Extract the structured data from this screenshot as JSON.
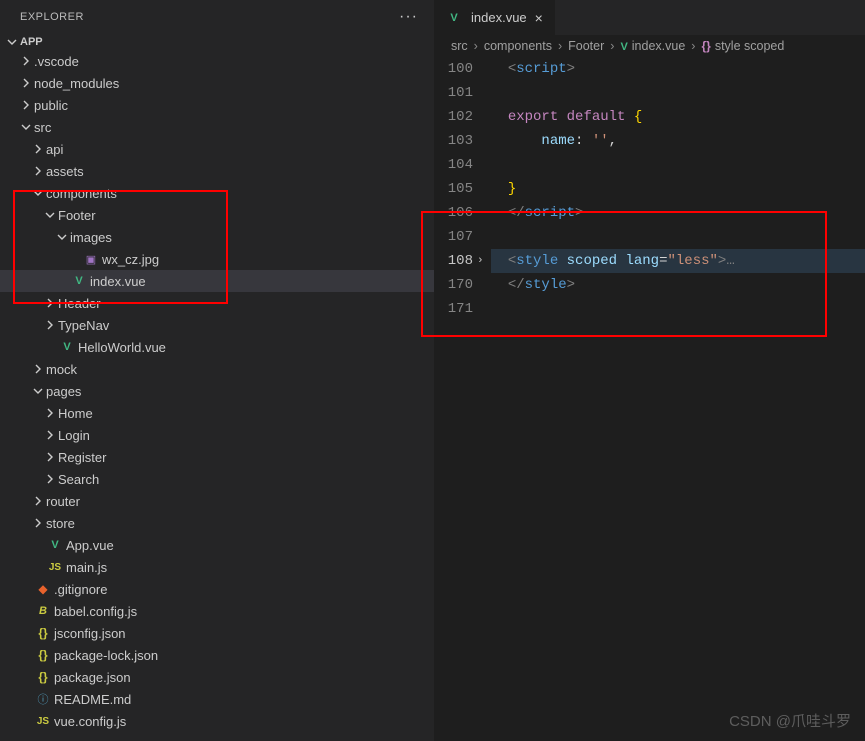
{
  "explorer": {
    "title": "EXPLORER",
    "section": "APP",
    "tree": [
      {
        "label": ".vscode",
        "icon": "chev-right",
        "indent": 1,
        "type": "folder-closed"
      },
      {
        "label": "node_modules",
        "icon": "chev-right",
        "indent": 1,
        "type": "folder-closed"
      },
      {
        "label": "public",
        "icon": "chev-right",
        "indent": 1,
        "type": "folder-closed"
      },
      {
        "label": "src",
        "icon": "chev-down",
        "indent": 1,
        "type": "folder-open"
      },
      {
        "label": "api",
        "icon": "chev-right",
        "indent": 2,
        "type": "folder-closed"
      },
      {
        "label": "assets",
        "icon": "chev-right",
        "indent": 2,
        "type": "folder-closed"
      },
      {
        "label": "components",
        "icon": "chev-down",
        "indent": 2,
        "type": "folder-open",
        "hl": true
      },
      {
        "label": "Footer",
        "icon": "chev-down",
        "indent": 3,
        "type": "folder-open",
        "hl": true
      },
      {
        "label": "images",
        "icon": "chev-down",
        "indent": 4,
        "type": "folder-open",
        "hl": true
      },
      {
        "label": "wx_cz.jpg",
        "icon": "image",
        "indent": 5,
        "type": "file",
        "hl": true
      },
      {
        "label": "index.vue",
        "icon": "vue",
        "indent": 4,
        "type": "file",
        "hl": true,
        "active": true
      },
      {
        "label": "Header",
        "icon": "chev-right",
        "indent": 3,
        "type": "folder-closed"
      },
      {
        "label": "TypeNav",
        "icon": "chev-right",
        "indent": 3,
        "type": "folder-closed"
      },
      {
        "label": "HelloWorld.vue",
        "icon": "vue",
        "indent": 3,
        "type": "file"
      },
      {
        "label": "mock",
        "icon": "chev-right",
        "indent": 2,
        "type": "folder-closed"
      },
      {
        "label": "pages",
        "icon": "chev-down",
        "indent": 2,
        "type": "folder-open"
      },
      {
        "label": "Home",
        "icon": "chev-right",
        "indent": 3,
        "type": "folder-closed"
      },
      {
        "label": "Login",
        "icon": "chev-right",
        "indent": 3,
        "type": "folder-closed"
      },
      {
        "label": "Register",
        "icon": "chev-right",
        "indent": 3,
        "type": "folder-closed"
      },
      {
        "label": "Search",
        "icon": "chev-right",
        "indent": 3,
        "type": "folder-closed"
      },
      {
        "label": "router",
        "icon": "chev-right",
        "indent": 2,
        "type": "folder-closed"
      },
      {
        "label": "store",
        "icon": "chev-right",
        "indent": 2,
        "type": "folder-closed"
      },
      {
        "label": "App.vue",
        "icon": "vue",
        "indent": 2,
        "type": "file"
      },
      {
        "label": "main.js",
        "icon": "js",
        "indent": 2,
        "type": "file"
      },
      {
        "label": ".gitignore",
        "icon": "git",
        "indent": 1,
        "type": "file"
      },
      {
        "label": "babel.config.js",
        "icon": "babel",
        "indent": 1,
        "type": "file"
      },
      {
        "label": "jsconfig.json",
        "icon": "braces",
        "indent": 1,
        "type": "file"
      },
      {
        "label": "package-lock.json",
        "icon": "braces",
        "indent": 1,
        "type": "file"
      },
      {
        "label": "package.json",
        "icon": "braces",
        "indent": 1,
        "type": "file"
      },
      {
        "label": "README.md",
        "icon": "info",
        "indent": 1,
        "type": "file"
      },
      {
        "label": "vue.config.js",
        "icon": "js",
        "indent": 1,
        "type": "file"
      }
    ]
  },
  "tab": {
    "label": "index.vue",
    "close": "×"
  },
  "breadcrumb": [
    "src",
    "components",
    "Footer",
    "index.vue",
    "style scoped"
  ],
  "code": {
    "lines": [
      {
        "n": "100",
        "tokens": [
          {
            "t": "  ",
            "c": "punc"
          },
          {
            "t": "<",
            "c": "tag"
          },
          {
            "t": "script",
            "c": "name"
          },
          {
            "t": ">",
            "c": "tag"
          }
        ]
      },
      {
        "n": "101",
        "tokens": []
      },
      {
        "n": "102",
        "tokens": [
          {
            "t": "  ",
            "c": "punc"
          },
          {
            "t": "export",
            "c": "kw"
          },
          {
            "t": " ",
            "c": "punc"
          },
          {
            "t": "default",
            "c": "kw"
          },
          {
            "t": " ",
            "c": "punc"
          },
          {
            "t": "{",
            "c": "brace"
          }
        ]
      },
      {
        "n": "103",
        "tokens": [
          {
            "t": "      ",
            "c": "punc"
          },
          {
            "t": "name",
            "c": "attr"
          },
          {
            "t": ":",
            "c": "punc"
          },
          {
            "t": " ",
            "c": "punc"
          },
          {
            "t": "''",
            "c": "str"
          },
          {
            "t": ",",
            "c": "punc"
          }
        ]
      },
      {
        "n": "104",
        "tokens": []
      },
      {
        "n": "105",
        "tokens": [
          {
            "t": "  ",
            "c": "punc"
          },
          {
            "t": "}",
            "c": "brace"
          }
        ]
      },
      {
        "n": "106",
        "tokens": [
          {
            "t": "  ",
            "c": "punc"
          },
          {
            "t": "</",
            "c": "tag"
          },
          {
            "t": "script",
            "c": "name"
          },
          {
            "t": ">",
            "c": "tag"
          }
        ]
      },
      {
        "n": "107",
        "tokens": []
      },
      {
        "n": "108",
        "current": true,
        "fold": true,
        "tokens": [
          {
            "t": "  ",
            "c": "punc"
          },
          {
            "t": "<",
            "c": "tag"
          },
          {
            "t": "style",
            "c": "name"
          },
          {
            "t": " ",
            "c": "punc"
          },
          {
            "t": "scoped",
            "c": "attr"
          },
          {
            "t": " ",
            "c": "punc"
          },
          {
            "t": "lang",
            "c": "attr"
          },
          {
            "t": "=",
            "c": "punc"
          },
          {
            "t": "\"less\"",
            "c": "str"
          },
          {
            "t": ">",
            "c": "tag"
          },
          {
            "t": "…",
            "c": "tag"
          }
        ]
      },
      {
        "n": "170",
        "tokens": [
          {
            "t": "  ",
            "c": "punc"
          },
          {
            "t": "</",
            "c": "tag"
          },
          {
            "t": "style",
            "c": "name"
          },
          {
            "t": ">",
            "c": "tag"
          }
        ]
      },
      {
        "n": "171",
        "tokens": []
      }
    ]
  },
  "watermark": "CSDN @爪哇斗罗"
}
